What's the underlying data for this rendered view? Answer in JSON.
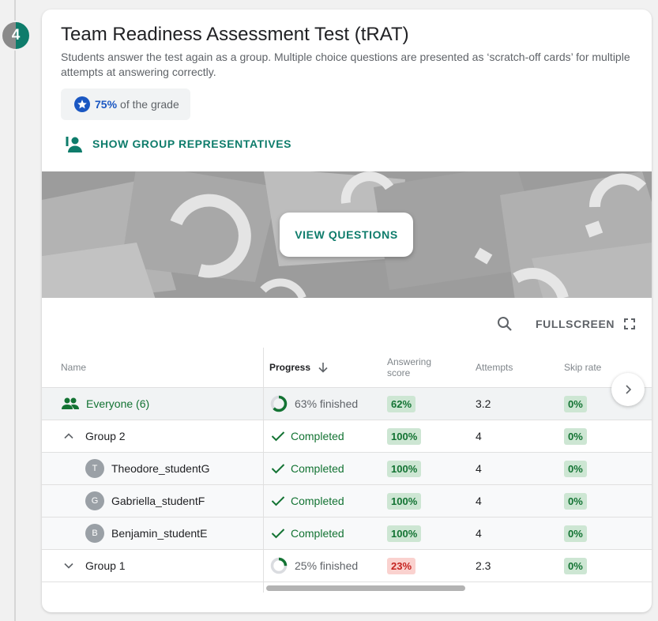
{
  "step": {
    "number": "4"
  },
  "card": {
    "title": "Team Readiness Assessment Test (tRAT)",
    "description": "Students answer the test again as a group. Multiple choice questions are presented as ‘scratch-off cards’ for multiple attempts at answering correctly.",
    "grade": {
      "percent": "75%",
      "suffix": "of the grade"
    },
    "group_reps_label": "SHOW GROUP REPRESENTATIVES",
    "view_questions_label": "VIEW QUESTIONS"
  },
  "toolbar": {
    "fullscreen_label": "FULLSCREEN"
  },
  "table": {
    "headers": {
      "name": "Name",
      "progress": "Progress",
      "score_line1": "Answering",
      "score_line2": "score",
      "attempts": "Attempts",
      "skip_rate": "Skip rate"
    },
    "rows": [
      {
        "name": "Everyone (6)",
        "progress": "63% finished",
        "progress_fraction": 0.63,
        "score": "62%",
        "attempts": "3.2",
        "skip": "0%"
      },
      {
        "name": "Group 2",
        "progress": "Completed",
        "score": "100%",
        "attempts": "4",
        "skip": "0%"
      },
      {
        "name": "Theodore_studentG",
        "initial": "T",
        "progress": "Completed",
        "score": "100%",
        "attempts": "4",
        "skip": "0%"
      },
      {
        "name": "Gabriella_studentF",
        "initial": "G",
        "progress": "Completed",
        "score": "100%",
        "attempts": "4",
        "skip": "0%"
      },
      {
        "name": "Benjamin_studentE",
        "initial": "B",
        "progress": "Completed",
        "score": "100%",
        "attempts": "4",
        "skip": "0%"
      },
      {
        "name": "Group 1",
        "progress": "25% finished",
        "progress_fraction": 0.25,
        "score": "23%",
        "attempts": "2.3",
        "skip": "0%"
      }
    ]
  },
  "colors": {
    "accent": "#0e7c6b",
    "grade_blue": "#1a57c2",
    "success": "#137333",
    "danger": "#c5221f"
  }
}
